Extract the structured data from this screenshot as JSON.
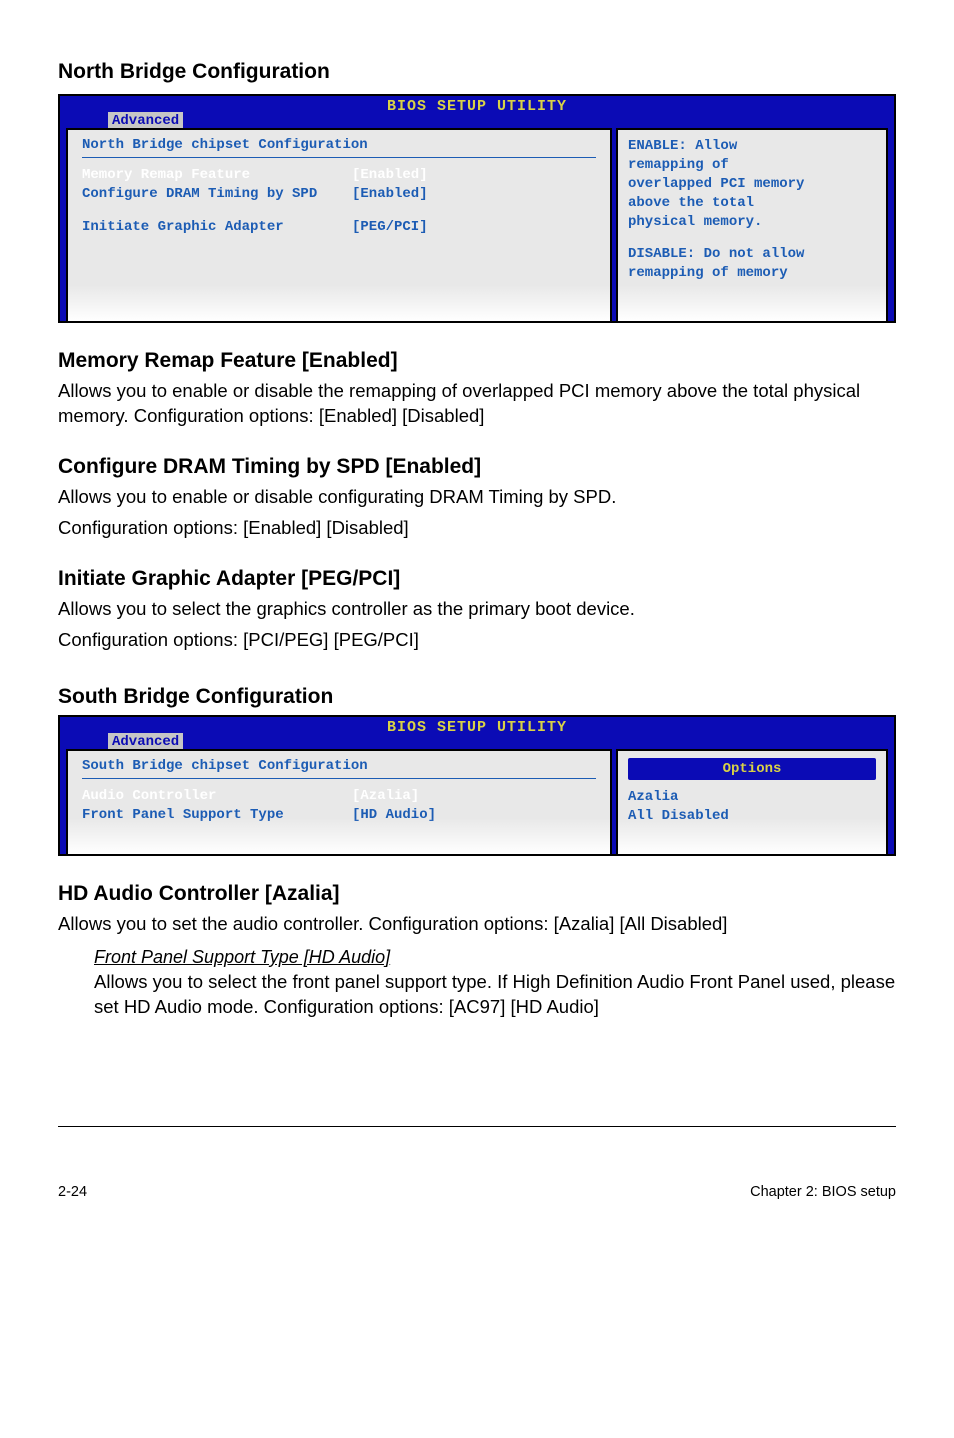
{
  "headings": {
    "north_bridge_config": "North Bridge Configuration",
    "memory_remap": "Memory Remap Feature [Enabled]",
    "configure_dram": "Configure DRAM Timing by SPD [Enabled]",
    "initiate_graphic": "Initiate Graphic Adapter [PEG/PCI]",
    "south_bridge_config": "South Bridge Configuration",
    "hd_audio": "HD Audio Controller [Azalia]"
  },
  "paragraphs": {
    "memory_remap": "Allows you to enable or disable the  remapping of overlapped PCI memory above the total physical memory. Configuration options: [Enabled] [Disabled]",
    "configure_dram_l1": "Allows you to enable or disable configurating DRAM Timing by SPD.",
    "configure_dram_l2": "Configuration options: [Enabled] [Disabled]",
    "initiate_graphic_l1": "Allows you to select the graphics controller as the primary boot device.",
    "initiate_graphic_l2": "Configuration options: [PCI/PEG] [PEG/PCI]",
    "hd_audio": "Allows you to set the audio controller. Configuration options: [Azalia] [All Disabled]",
    "front_panel_heading": " Front Panel Support Type [HD Audio]",
    "front_panel_body": "Allows you to select the front panel support type. If High Definition Audio Front Panel used, please set HD Audio mode. Configuration options: [AC97] [HD Audio]"
  },
  "bios1": {
    "title": "BIOS SETUP UTILITY",
    "tab": "Advanced",
    "panel_title": "North Bridge chipset Configuration",
    "row1": {
      "label": "Memory Remap Feature",
      "value": "[Enabled]"
    },
    "row2": {
      "label": "Configure DRAM Timing by SPD",
      "value": "[Enabled]"
    },
    "row3": {
      "label": "Initiate Graphic Adapter",
      "value": "[PEG/PCI]"
    },
    "help_l1": "ENABLE: Allow",
    "help_l2": "remapping of",
    "help_l3": "overlapped PCI memory",
    "help_l4": "above the total",
    "help_l5": "physical memory.",
    "help_l6": "DISABLE: Do not allow",
    "help_l7": "remapping of memory"
  },
  "bios2": {
    "title": "BIOS SETUP UTILITY",
    "tab": "Advanced",
    "panel_title": "South Bridge chipset Configuration",
    "row1": {
      "label": "Audio Controller",
      "value": "[Azalia]"
    },
    "row2": {
      "label": " Front Panel Support Type",
      "value": "[HD Audio]"
    },
    "options_title": "Options",
    "opt1": "Azalia",
    "opt2": "All Disabled"
  },
  "footer": {
    "left": "2-24",
    "right": "Chapter 2: BIOS setup"
  }
}
